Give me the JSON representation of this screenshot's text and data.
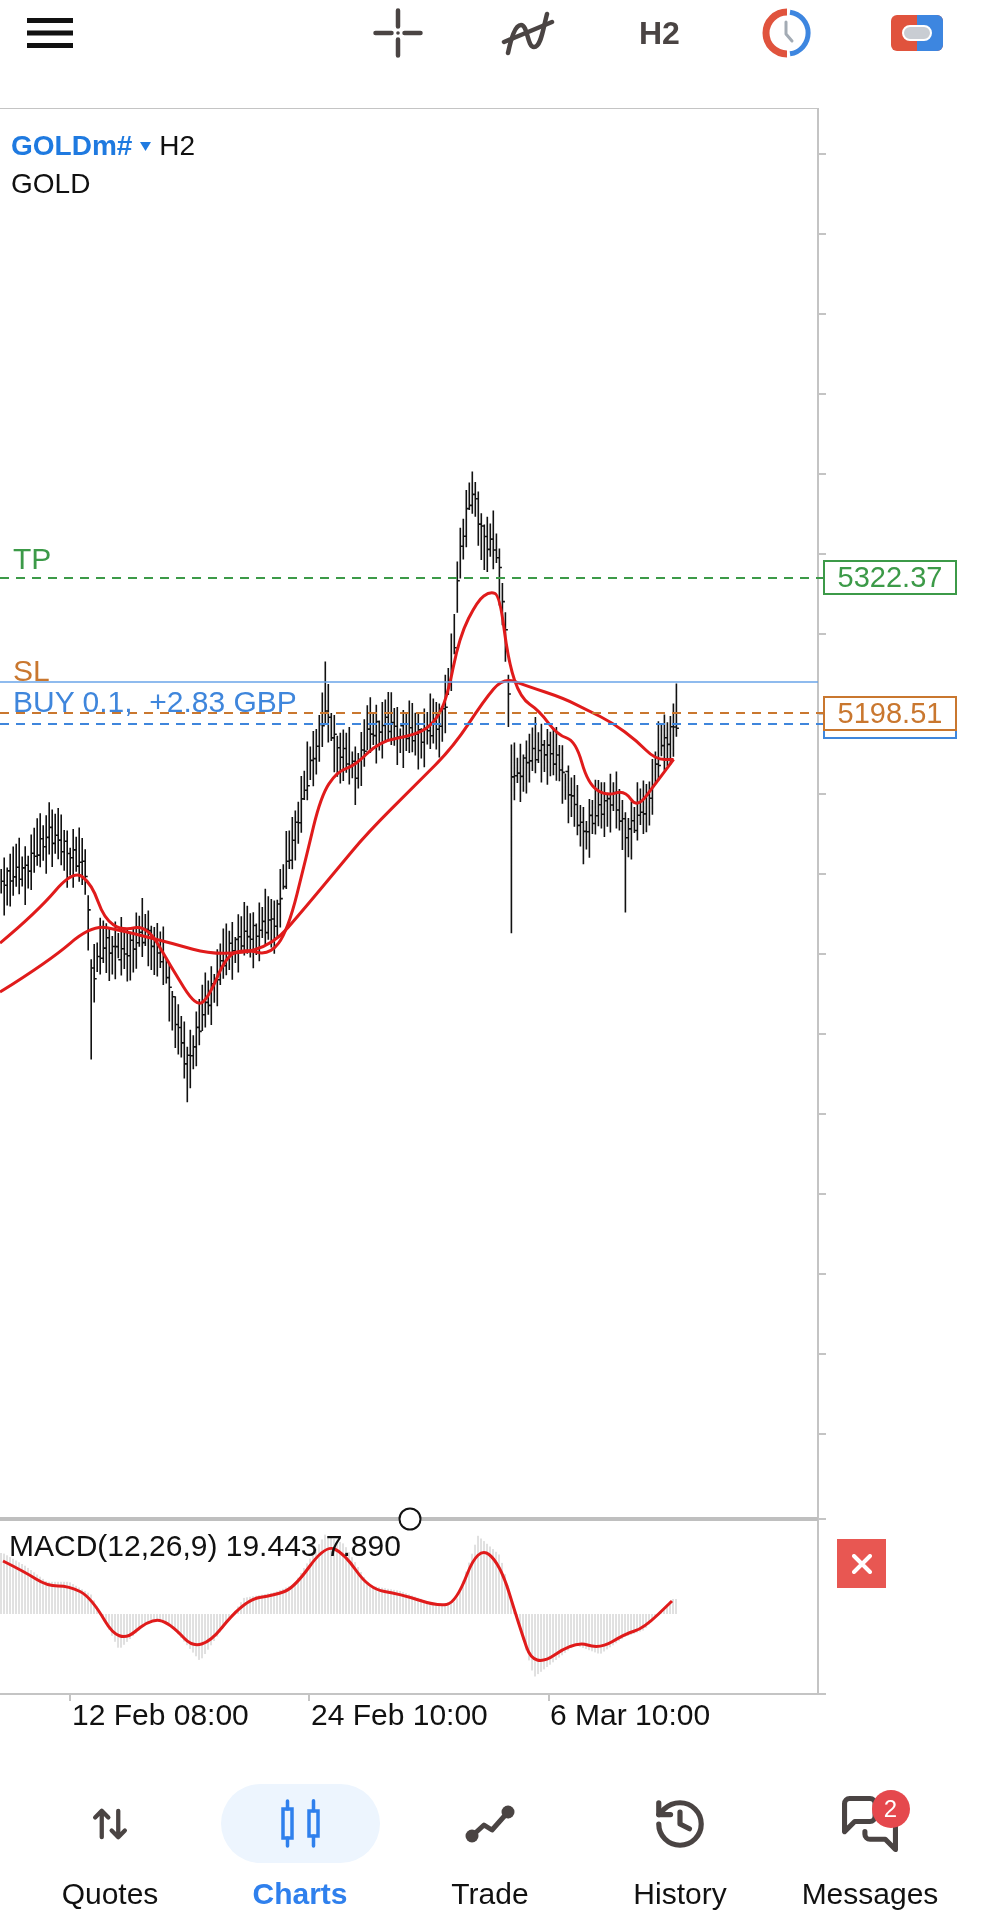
{
  "toolbar": {
    "timeframe": "H2"
  },
  "chart": {
    "symbol": "GOLDm#",
    "timeframe": "H2",
    "description": "GOLD",
    "levels": [
      {
        "kind": "take_profit",
        "label": "TP",
        "price": "5322.37",
        "color": "#3c9a48"
      },
      {
        "kind": "stop_loss",
        "label": "SL",
        "price": "5198.51",
        "color": "#c9772f"
      },
      {
        "kind": "position",
        "label": "BUY 0.1,  +2.83 GBP",
        "color": "#3f86dc"
      }
    ],
    "indicator": {
      "label": "MACD(12,26,9) 19.443 7.890"
    },
    "time_axis": [
      "12 Feb 08:00",
      "24 Feb 10:00",
      "6 Mar 10:00"
    ]
  },
  "nav": [
    {
      "kind": "quotes",
      "label": "Quotes",
      "selected": false
    },
    {
      "kind": "charts",
      "label": "Charts",
      "selected": true
    },
    {
      "kind": "trade",
      "label": "Trade",
      "selected": false
    },
    {
      "kind": "history",
      "label": "History",
      "selected": false
    },
    {
      "kind": "messages",
      "label": "Messages",
      "selected": false,
      "badge": "2"
    }
  ]
}
